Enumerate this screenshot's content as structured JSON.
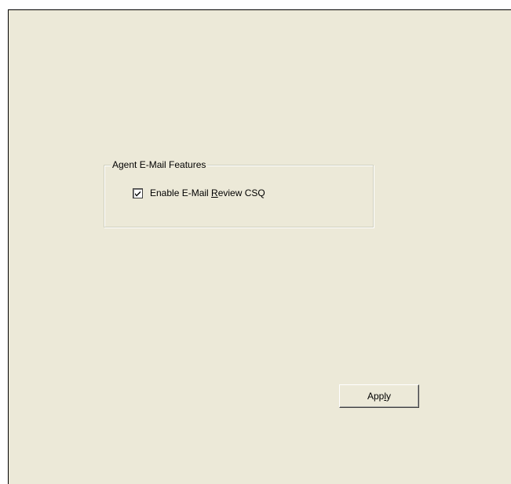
{
  "group": {
    "legend": "Agent E-Mail Features"
  },
  "checkbox": {
    "label_prefix": "Enable E-Mail ",
    "label_mnemonic": "R",
    "label_suffix": "eview CSQ",
    "checked": true
  },
  "buttons": {
    "apply_prefix": "App",
    "apply_mnemonic": "l",
    "apply_suffix": "y"
  },
  "icons": {
    "check": "checkmark-icon"
  },
  "colors": {
    "panel_background": "#ece9d8",
    "window_border": "#000000"
  }
}
